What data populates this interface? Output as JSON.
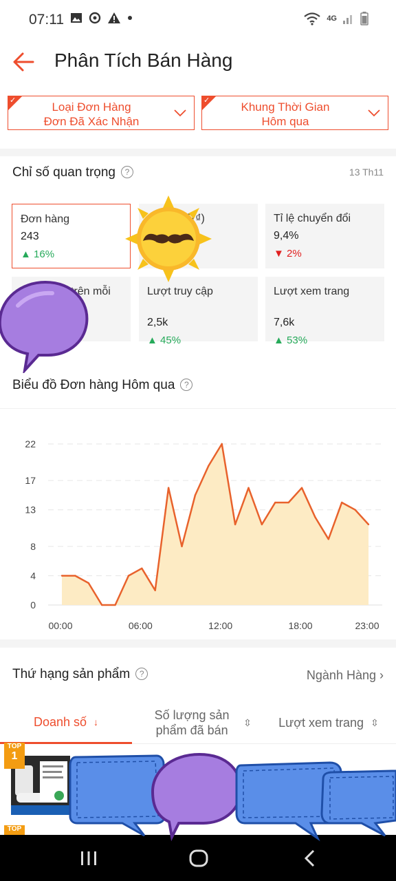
{
  "status_bar": {
    "time": "07:11",
    "network": "4G"
  },
  "header": {
    "title": "Phân Tích Bán Hàng"
  },
  "filters": [
    {
      "line1": "Loại Đơn Hàng",
      "line2": "Đơn Đã Xác Nhận"
    },
    {
      "line1": "Khung Thời Gian",
      "line2": "Hôm qua"
    }
  ],
  "key_metrics": {
    "title": "Chỉ số quan trọng",
    "date": "13 Th11",
    "cards": [
      {
        "label": "Đơn hàng",
        "value": "243",
        "change": "16%",
        "direction": "up"
      },
      {
        "label": "ố(₫)",
        "value": "",
        "change": "",
        "direction": ""
      },
      {
        "label": "Tỉ lệ chuyển đổi",
        "value": "9,4%",
        "change": "2%",
        "direction": "down"
      },
      {
        "label": "trên mỗi",
        "value": "",
        "change": "",
        "direction": ""
      },
      {
        "label": "Lượt truy cập",
        "value": "2,5k",
        "change": "45%",
        "direction": "up"
      },
      {
        "label": "Lượt xem trang",
        "value": "7,6k",
        "change": "53%",
        "direction": "up"
      }
    ]
  },
  "chart_title": "Biểu đồ Đơn hàng Hôm qua",
  "chart_data": {
    "type": "area",
    "title": "Biểu đồ Đơn hàng Hôm qua",
    "xlabel": "",
    "ylabel": "",
    "y_ticks": [
      "0",
      "4",
      "8",
      "13",
      "17",
      "22"
    ],
    "ylim": [
      0,
      22
    ],
    "x_ticks": [
      "00:00",
      "06:00",
      "12:00",
      "18:00",
      "23:00"
    ],
    "x_hours": [
      0,
      1,
      2,
      3,
      4,
      5,
      6,
      7,
      8,
      9,
      10,
      11,
      12,
      13,
      14,
      15,
      16,
      17,
      18,
      19,
      20,
      21,
      22,
      23
    ],
    "values": [
      4,
      4,
      3,
      0,
      0,
      4,
      5,
      2,
      16,
      8,
      15,
      19,
      22,
      11,
      16,
      11,
      14,
      14,
      16,
      12,
      9,
      14,
      13,
      11
    ],
    "colors": {
      "line": "#e8622c",
      "fill": "#fdebc4"
    }
  },
  "ranking": {
    "title": "Thứ hạng sản phẩm",
    "link": "Ngành Hàng",
    "tabs": [
      {
        "label": "Doanh số"
      },
      {
        "label": "Số lượng sản phẩm đã bán"
      },
      {
        "label": "Lượt xem trang"
      }
    ],
    "badges": [
      {
        "text": "TOP",
        "num": "1"
      },
      {
        "text": "TOP",
        "num": ""
      }
    ]
  },
  "colors": {
    "accent": "#ee4d2d",
    "up": "#26aa5a",
    "down": "#e02020"
  }
}
